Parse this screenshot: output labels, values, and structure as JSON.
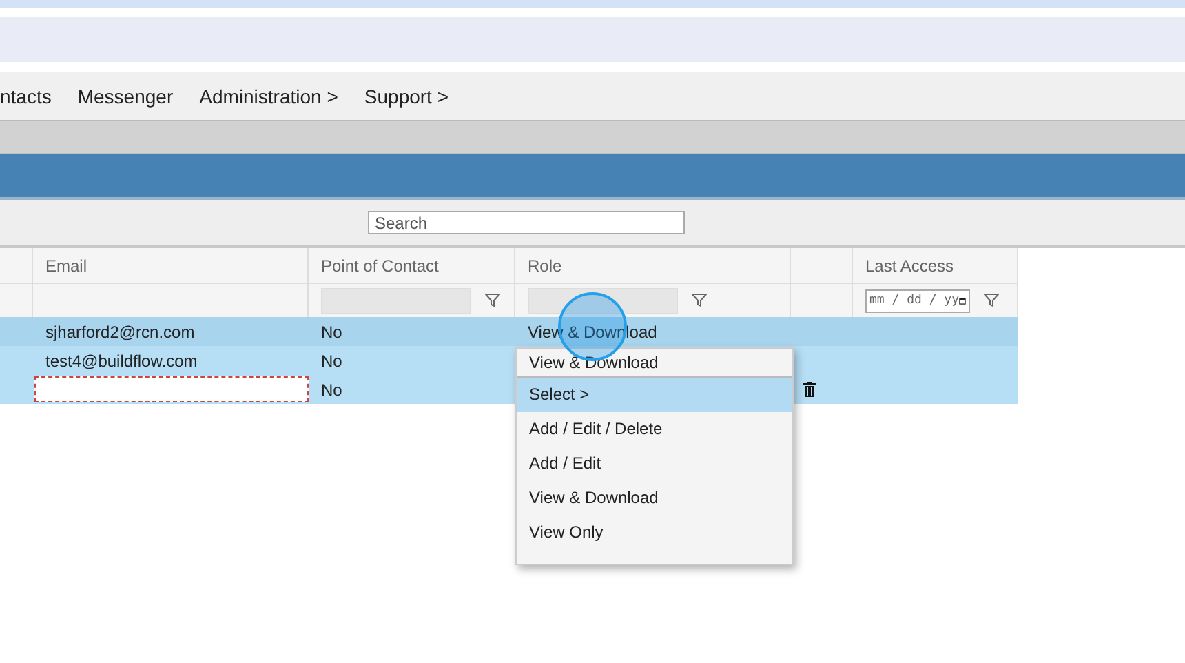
{
  "nav": {
    "items": [
      {
        "label": "ntacts"
      },
      {
        "label": "Messenger"
      },
      {
        "label": "Administration >"
      },
      {
        "label": "Support >"
      }
    ]
  },
  "toolbar": {
    "search": {
      "placeholder": "Search"
    }
  },
  "table": {
    "columns": [
      {
        "kind": "plain"
      },
      {
        "label": "Email",
        "kind": "plain"
      },
      {
        "label": "Point of Contact",
        "kind": "text_filter"
      },
      {
        "label": "Role",
        "kind": "text_filter"
      },
      {
        "kind": "plain"
      },
      {
        "label": "Last Access",
        "kind": "date_filter",
        "placeholder": "mm / dd / yy"
      }
    ],
    "rows": [
      {
        "selected": true,
        "email": "sjharford2@rcn.com",
        "editing": false,
        "point_of_contact": "No",
        "role": "View & Download",
        "deletable": false
      },
      {
        "selected": false,
        "email": "test4@buildflow.com",
        "editing": false,
        "point_of_contact": "No",
        "role": "",
        "deletable": false
      },
      {
        "selected": false,
        "email": "",
        "editing": true,
        "point_of_contact": "No",
        "role": "",
        "deletable": true
      }
    ]
  },
  "role_menu": {
    "current": "View & Download",
    "items": [
      {
        "label": "Select >",
        "highlighted": true
      },
      {
        "label": "Add / Edit / Delete",
        "highlighted": false
      },
      {
        "label": "Add / Edit",
        "highlighted": false
      },
      {
        "label": "View & Download",
        "highlighted": false
      },
      {
        "label": "View Only",
        "highlighted": false
      }
    ]
  }
}
